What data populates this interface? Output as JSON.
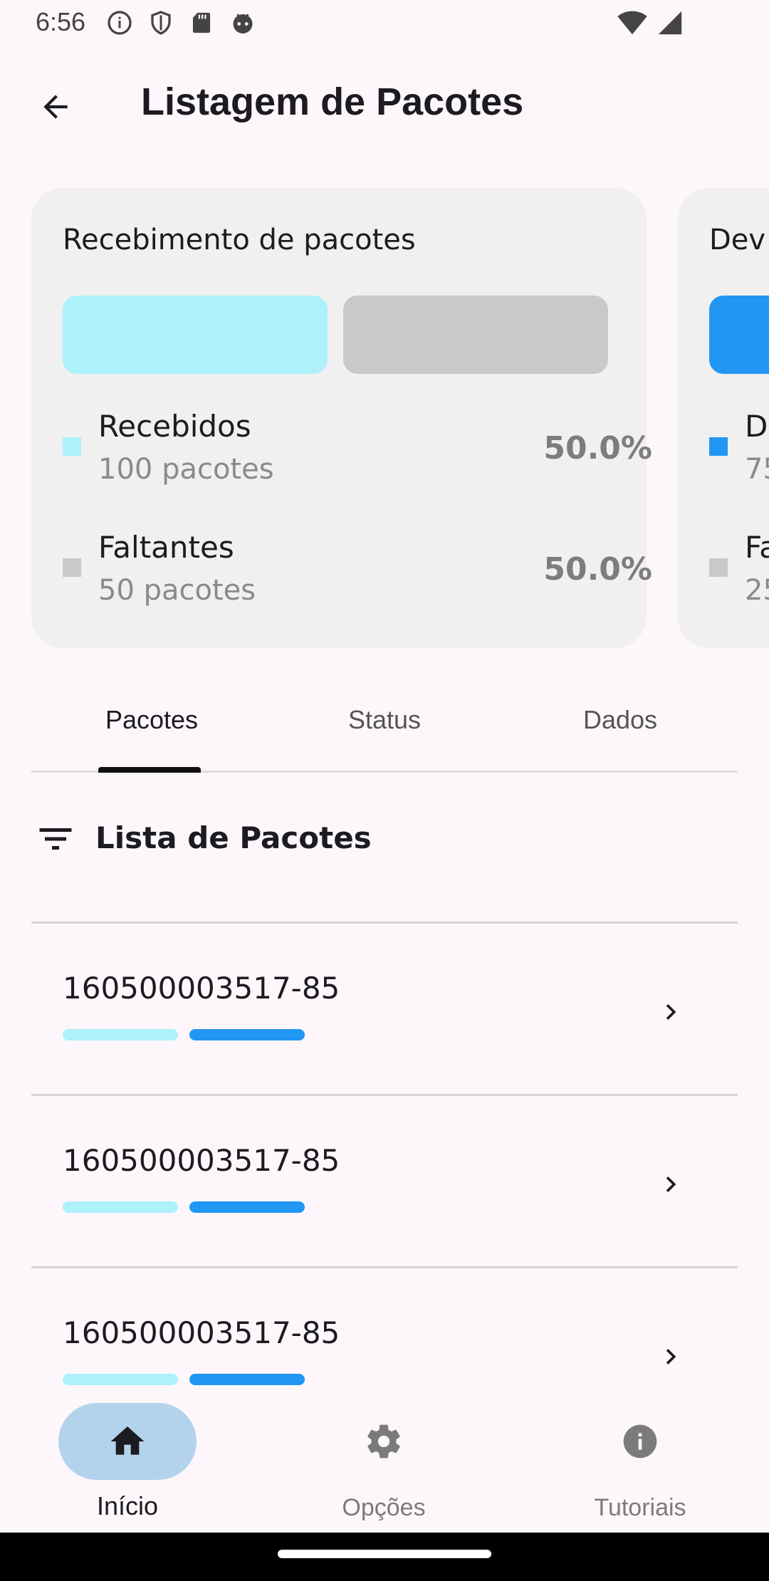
{
  "status_bar": {
    "time": "6:56",
    "left_icons": [
      "info-circle-icon",
      "shield-icon",
      "sd-card-icon",
      "android-head-icon"
    ],
    "right_icons": [
      "wifi-icon",
      "signal-icon"
    ]
  },
  "app_bar": {
    "back_icon": "arrow-left-icon",
    "title": "Listagem de Pacotes"
  },
  "cards": [
    {
      "title": "Recebimento de pacotes",
      "colors": {
        "primary": "#adf1fb",
        "secondary": "#c9c9c9"
      },
      "progress_fraction": 0.5,
      "legend": [
        {
          "name": "Recebidos",
          "sub": "100 pacotes",
          "percent": "50.0%",
          "color": "#adf1fb"
        },
        {
          "name": "Faltantes",
          "sub": "50 pacotes",
          "percent": "50.0%",
          "color": "#c9c9c9"
        }
      ]
    },
    {
      "title": "Dev",
      "colors": {
        "primary": "#2196f3",
        "secondary": "#c9c9c9"
      },
      "legend": [
        {
          "name": "D",
          "sub": "75",
          "color": "#2196f3"
        },
        {
          "name": "Fa",
          "sub": "25",
          "color": "#c9c9c9"
        }
      ]
    }
  ],
  "tabs": [
    {
      "label": "Pacotes",
      "active": true
    },
    {
      "label": "Status",
      "active": false
    },
    {
      "label": "Dados",
      "active": false
    }
  ],
  "list": {
    "filter_icon": "filter-list-icon",
    "title": "Lista de Pacotes",
    "items": [
      {
        "code": "160500003517-85",
        "bar_colors": [
          "#adf1fb",
          "#2196f3"
        ]
      },
      {
        "code": "160500003517-85",
        "bar_colors": [
          "#adf1fb",
          "#2196f3"
        ]
      },
      {
        "code": "160500003517-85",
        "bar_colors": [
          "#adf1fb",
          "#2196f3"
        ]
      }
    ],
    "chevron_icon": "chevron-right-icon"
  },
  "bottom_nav": [
    {
      "label": "Início",
      "icon": "home-icon",
      "active": true
    },
    {
      "label": "Opções",
      "icon": "gear-icon",
      "active": false
    },
    {
      "label": "Tutoriais",
      "icon": "info-icon",
      "active": false
    }
  ],
  "theme": {
    "active_pill": "#b3d3ec",
    "inactive_icon": "#7b7b7b"
  }
}
